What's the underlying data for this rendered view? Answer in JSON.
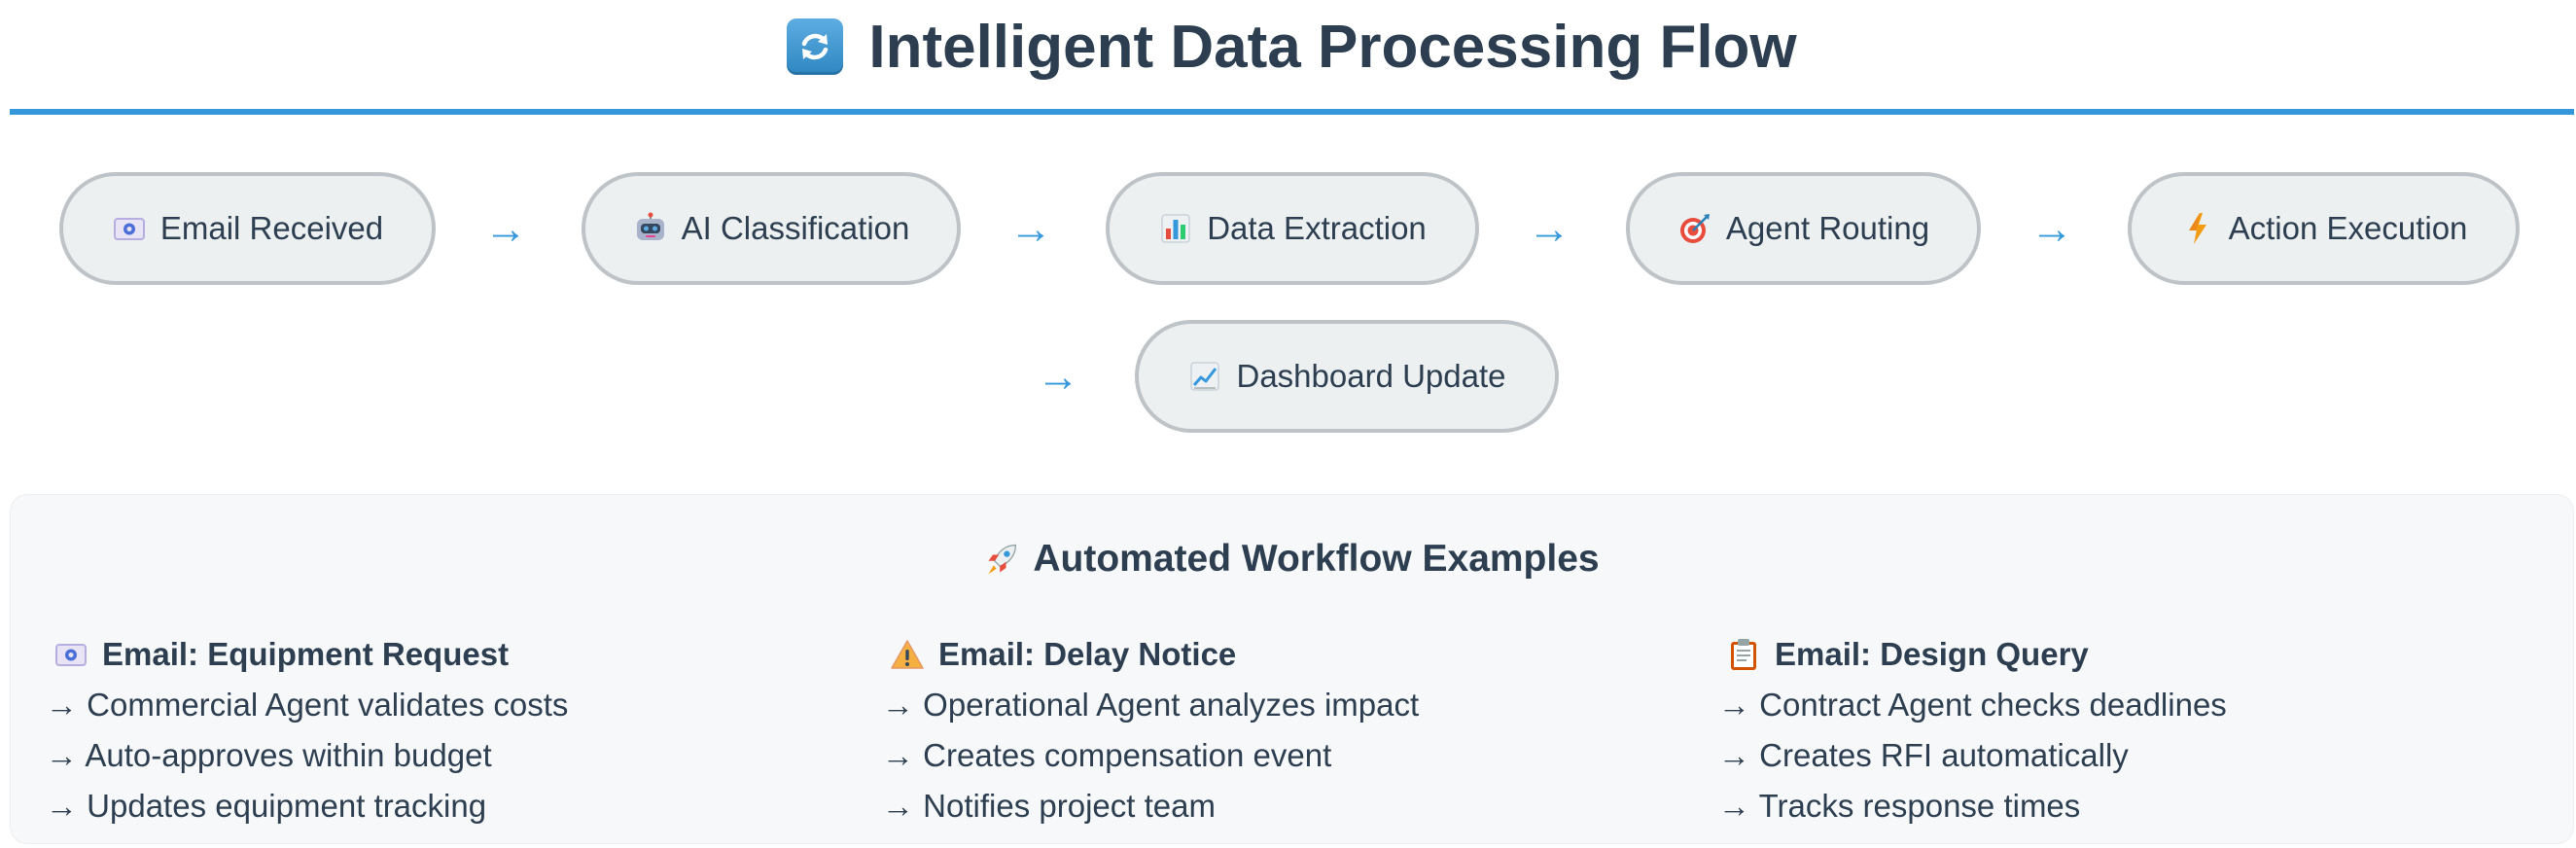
{
  "header": {
    "title": "Intelligent Data Processing Flow",
    "icon": "refresh-arrows-icon"
  },
  "flow": {
    "nodes": [
      {
        "label": "Email Received",
        "icon": "email-icon"
      },
      {
        "label": "AI Classification",
        "icon": "robot-icon"
      },
      {
        "label": "Data Extraction",
        "icon": "bar-chart-icon"
      },
      {
        "label": "Agent Routing",
        "icon": "target-icon"
      },
      {
        "label": "Action Execution",
        "icon": "lightning-icon"
      },
      {
        "label": "Dashboard Update",
        "icon": "line-chart-icon"
      }
    ],
    "arrow": "→"
  },
  "examples": {
    "title": "Automated Workflow Examples",
    "title_icon": "rocket-icon",
    "columns": [
      {
        "heading": "Email: Equipment Request",
        "icon": "email-icon",
        "lines": [
          "→ Commercial Agent validates costs",
          "→ Auto-approves within budget",
          "→ Updates equipment tracking"
        ]
      },
      {
        "heading": "Email: Delay Notice",
        "icon": "warning-icon",
        "lines": [
          "→ Operational Agent analyzes impact",
          "→ Creates compensation event",
          "→ Notifies project team"
        ]
      },
      {
        "heading": "Email: Design Query",
        "icon": "clipboard-icon",
        "lines": [
          "→ Contract Agent checks deadlines",
          "→ Creates RFI automatically",
          "→ Tracks response times"
        ]
      }
    ]
  },
  "colors": {
    "accent": "#3498db",
    "text": "#2c3e50",
    "node_bg": "#ecf0f1",
    "node_border": "#bdc3c7"
  }
}
